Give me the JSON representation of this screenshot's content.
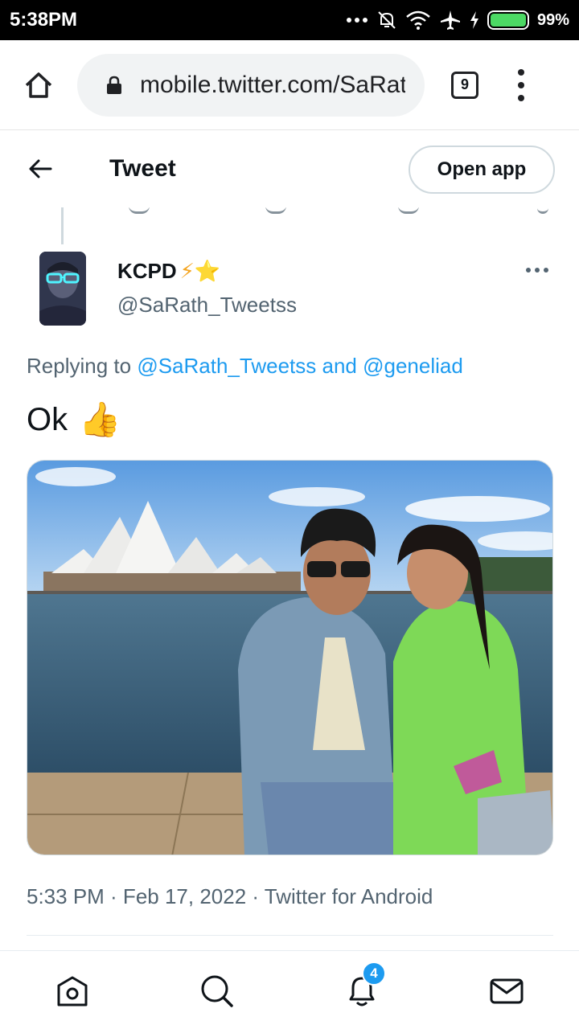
{
  "status_bar": {
    "time": "5:38PM",
    "battery_percent": "99%",
    "battery_level": 0.99,
    "icons": [
      "more-dots-icon",
      "mute-icon",
      "wifi-icon",
      "airplane-icon",
      "charging-icon",
      "battery-icon"
    ]
  },
  "browser": {
    "url": "mobile.twitter.com/SaRath_Tweetss",
    "tab_count": "9"
  },
  "header": {
    "title": "Tweet",
    "open_app_label": "Open app"
  },
  "tweet": {
    "author_name": "KCPD",
    "author_emojis": "⚡⭐",
    "author_handle": "@SaRath_Tweetss",
    "replying_to_prefix": "Replying to ",
    "replying_to_user1": "@SaRath_Tweetss",
    "replying_to_and": " and ",
    "replying_to_user2": "@geneliad",
    "text": "Ok",
    "text_emoji": "👍",
    "timestamp": "5:33 PM · Feb 17, 2022 · Twitter for Android"
  },
  "bottom_nav": {
    "items": [
      "home-icon",
      "search-icon",
      "notifications-icon",
      "messages-icon"
    ],
    "notification_count": "4"
  },
  "colors": {
    "accent": "#1d9bf0",
    "secondary_text": "#536471",
    "status_bar": "#000000"
  }
}
